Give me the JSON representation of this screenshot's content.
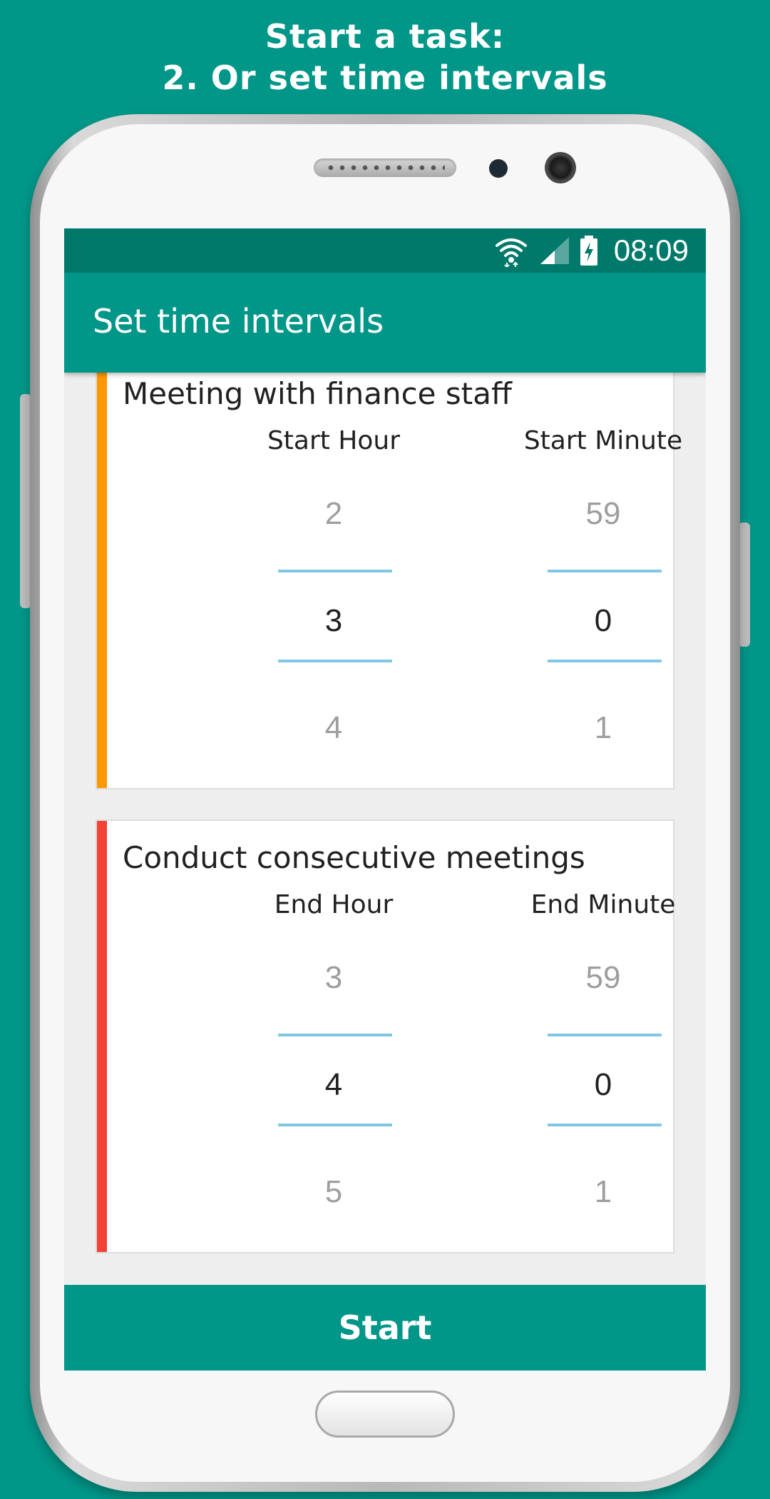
{
  "promo": {
    "line1": "Start a task:",
    "line2": "2. Or set time intervals"
  },
  "status_bar": {
    "time": "08:09",
    "icons": [
      "wifi-icon",
      "signal-icon",
      "battery-charging-icon"
    ]
  },
  "app_bar": {
    "title": "Set time intervals"
  },
  "cards": [
    {
      "title": "Meeting with finance staff",
      "accent_color": "#ff9800",
      "pickers": [
        {
          "label": "Start Hour",
          "prev": "2",
          "current": "3",
          "next": "4"
        },
        {
          "label": "Start Minute",
          "prev": "59",
          "current": "0",
          "next": "1"
        }
      ]
    },
    {
      "title": "Conduct consecutive meetings",
      "accent_color": "#f44336",
      "pickers": [
        {
          "label": "End Hour",
          "prev": "3",
          "current": "4",
          "next": "5"
        },
        {
          "label": "End Minute",
          "prev": "59",
          "current": "0",
          "next": "1"
        }
      ]
    }
  ],
  "start_button": {
    "label": "Start"
  },
  "colors": {
    "background": "#009688",
    "status_bar": "#00796b",
    "primary": "#009688",
    "picker_divider": "#7ec8e3"
  }
}
